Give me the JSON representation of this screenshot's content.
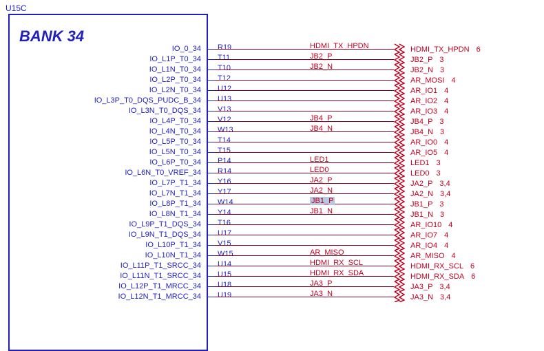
{
  "refdes": "U15C",
  "bank_title": "BANK 34",
  "rows": [
    {
      "pin": "IO_0_34",
      "num": "R19",
      "net": "HDMI_TX_HPDN",
      "port": "HDMI_TX_HPDN",
      "ref": "6"
    },
    {
      "pin": "IO_L1P_T0_34",
      "num": "T11",
      "net": "JB2_P",
      "port": "JB2_P",
      "ref": "3"
    },
    {
      "pin": "IO_L1N_T0_34",
      "num": "T10",
      "net": "JB2_N",
      "port": "JB2_N",
      "ref": "3"
    },
    {
      "pin": "IO_L2P_T0_34",
      "num": "T12",
      "net": "",
      "port": "AR_MOSI",
      "ref": "4"
    },
    {
      "pin": "IO_L2N_T0_34",
      "num": "U12",
      "net": "",
      "port": "AR_IO1",
      "ref": "4"
    },
    {
      "pin": "IO_L3P_T0_DQS_PUDC_B_34",
      "num": "U13",
      "net": "",
      "port": "AR_IO2",
      "ref": "4"
    },
    {
      "pin": "IO_L3N_T0_DQS_34",
      "num": "V13",
      "net": "",
      "port": "AR_IO3",
      "ref": "4"
    },
    {
      "pin": "IO_L4P_T0_34",
      "num": "V12",
      "net": "JB4_P",
      "port": "JB4_P",
      "ref": "3"
    },
    {
      "pin": "IO_L4N_T0_34",
      "num": "W13",
      "net": "JB4_N",
      "port": "JB4_N",
      "ref": "3"
    },
    {
      "pin": "IO_L5P_T0_34",
      "num": "T14",
      "net": "",
      "port": "AR_IO0",
      "ref": "4"
    },
    {
      "pin": "IO_L5N_T0_34",
      "num": "T15",
      "net": "",
      "port": "AR_IO5",
      "ref": "4"
    },
    {
      "pin": "IO_L6P_T0_34",
      "num": "P14",
      "net": "LED1",
      "port": "LED1",
      "ref": "3"
    },
    {
      "pin": "IO_L6N_T0_VREF_34",
      "num": "R14",
      "net": "LED0",
      "port": "LED0",
      "ref": "3"
    },
    {
      "pin": "IO_L7P_T1_34",
      "num": "Y16",
      "net": "JA2_P",
      "port": "JA2_P",
      "ref": "3,4"
    },
    {
      "pin": "IO_L7N_T1_34",
      "num": "Y17",
      "net": "JA2_N",
      "port": "JA2_N",
      "ref": "3,4"
    },
    {
      "pin": "IO_L8P_T1_34",
      "num": "W14",
      "net": "JB1_P",
      "hl": true,
      "port": "JB1_P",
      "ref": "3"
    },
    {
      "pin": "IO_L8N_T1_34",
      "num": "Y14",
      "net": "JB1_N",
      "port": "JB1_N",
      "ref": "3"
    },
    {
      "pin": "IO_L9P_T1_DQS_34",
      "num": "T16",
      "net": "",
      "port": "AR_IO10",
      "ref": "4"
    },
    {
      "pin": "IO_L9N_T1_DQS_34",
      "num": "U17",
      "net": "",
      "port": "AR_IO7",
      "ref": "4"
    },
    {
      "pin": "IO_L10P_T1_34",
      "num": "V15",
      "net": "",
      "port": "AR_IO4",
      "ref": "4"
    },
    {
      "pin": "IO_L10N_T1_34",
      "num": "W15",
      "net": "AR_MISO",
      "port": "AR_MISO",
      "ref": "4"
    },
    {
      "pin": "IO_L11P_T1_SRCC_34",
      "num": "U14",
      "net": "HDMI_RX_SCL",
      "port": "HDMI_RX_SCL",
      "ref": "6"
    },
    {
      "pin": "IO_L11N_T1_SRCC_34",
      "num": "U15",
      "net": "HDMI_RX_SDA",
      "port": "HDMI_RX_SDA",
      "ref": "6"
    },
    {
      "pin": "IO_L12P_T1_MRCC_34",
      "num": "U18",
      "net": "JA3_P",
      "port": "JA3_P",
      "ref": "3,4"
    },
    {
      "pin": "IO_L12N_T1_MRCC_34",
      "num": "U19",
      "net": "JA3_N",
      "port": "JA3_N",
      "ref": "3,4"
    }
  ],
  "port_yoffset": [
    7,
    7,
    7,
    7,
    7,
    7,
    7,
    7,
    7,
    7,
    7,
    7,
    7,
    7,
    7,
    7,
    7,
    7,
    7,
    7,
    7,
    7,
    7,
    7,
    7
  ]
}
